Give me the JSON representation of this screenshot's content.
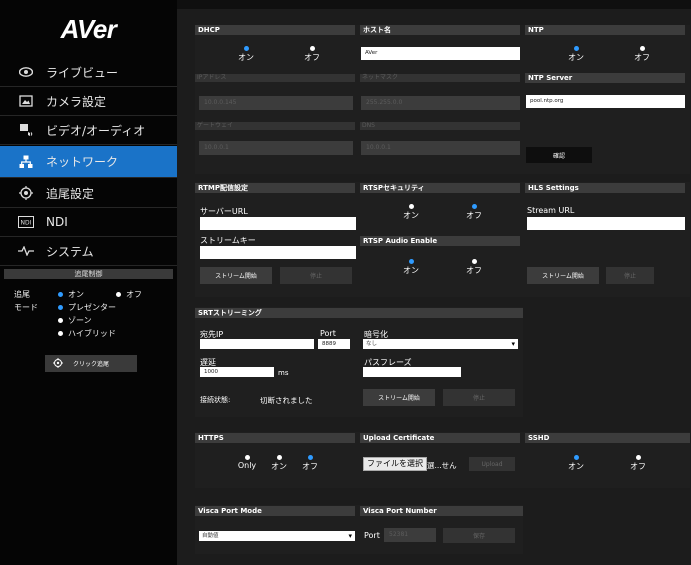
{
  "sidebar": {
    "logo": "AVer",
    "items": [
      {
        "label": "ライブビュー",
        "icon": "eye-icon",
        "active": false
      },
      {
        "label": "カメラ設定",
        "icon": "image-icon",
        "active": false
      },
      {
        "label": "ビデオ/オーディオ",
        "icon": "video-audio-icon",
        "active": false
      },
      {
        "label": "ネットワーク",
        "icon": "network-icon",
        "active": true
      },
      {
        "label": "追尾設定",
        "icon": "tracking-icon",
        "active": false
      },
      {
        "label": "NDI",
        "icon": "ndi-icon",
        "active": false
      },
      {
        "label": "システム",
        "icon": "system-icon",
        "active": false
      }
    ],
    "tracking_control": {
      "title": "追尾制御",
      "tracking_label": "追尾",
      "on": "オン",
      "off": "オフ",
      "mode_label": "モード",
      "modes": [
        "プレゼンター",
        "ゾーン",
        "ハイブリッド"
      ],
      "click_button": "クリック追尾"
    }
  },
  "dhcp": {
    "title": "DHCP",
    "on": "オン",
    "off": "オフ",
    "ip_label": "IPアドレス",
    "ip_value": "10.0.0.145",
    "gateway_label": "ゲートウェイ",
    "gateway_value": "10.0.0.1"
  },
  "host": {
    "title": "ホスト名",
    "value": "AVer",
    "netmask_label": "ネットマスク",
    "netmask_value": "255.255.0.0",
    "dns_label": "DNS",
    "dns_value": "10.0.0.1"
  },
  "ntp": {
    "title": "NTP",
    "on": "オン",
    "off": "オフ",
    "server_title": "NTP Server",
    "server_value": "pool.ntp.org",
    "apply": "確認"
  },
  "rtmp": {
    "title": "RTMP配信設定",
    "url_label": "サーバーURL",
    "key_label": "ストリームキー",
    "start": "ストリーム開始",
    "stop": "停止"
  },
  "rtsp": {
    "title": "RTSPセキュリティ",
    "on": "オン",
    "off": "オフ",
    "audio_title": "RTSP Audio Enable",
    "audio_on": "オン",
    "audio_off": "オフ"
  },
  "hls": {
    "title": "HLS Settings",
    "url_label": "Stream URL",
    "start": "ストリーム開始",
    "stop": "停止"
  },
  "srt": {
    "title": "SRTストリーミング",
    "ip_label": "宛先IP",
    "port_label": "Port",
    "port_value": "8889",
    "latency_label": "遅延",
    "latency_value": "1000",
    "latency_unit": "ms",
    "encrypt_label": "暗号化",
    "encrypt_value": "なし",
    "pass_label": "パスフレーズ",
    "status_label": "接続状態:",
    "status_value": "切断されました",
    "start": "ストリーム開始",
    "stop": "停止"
  },
  "https": {
    "title": "HTTPS",
    "only": "Only",
    "on": "オン",
    "off": "オフ"
  },
  "cert": {
    "title": "Upload Certificate",
    "file_button": "ファイルを選択",
    "file_status": "選...せん",
    "upload": "Upload"
  },
  "sshd": {
    "title": "SSHD",
    "on": "オン",
    "off": "オフ"
  },
  "visca_mode": {
    "title": "Visca Port Mode",
    "value": "自動値"
  },
  "visca_port": {
    "title": "Visca Port Number",
    "port_label": "Port",
    "port_value": "52381",
    "save": "保存"
  },
  "colors": {
    "accent": "#1a73c8",
    "radio_on": "#2f9bff",
    "panel": "#1f1f1f",
    "header": "#3c3c3c"
  }
}
